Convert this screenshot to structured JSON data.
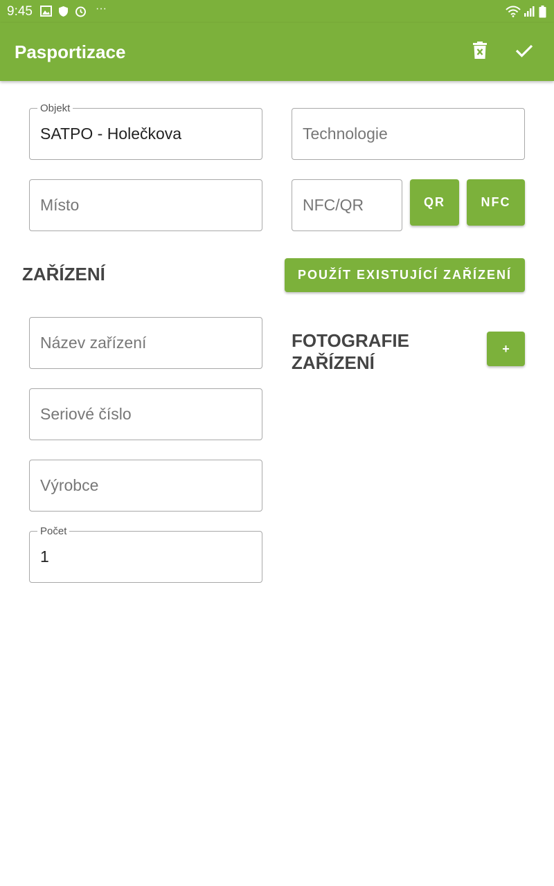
{
  "status_bar": {
    "time": "9:45",
    "overflow": "···",
    "icons": [
      "image-icon",
      "shield-icon",
      "alarm-icon",
      "wifi-icon",
      "signal-icon",
      "battery-icon"
    ]
  },
  "app_bar": {
    "title": "Pasportizace",
    "actions": [
      "delete-icon",
      "check-icon"
    ]
  },
  "form": {
    "objekt": {
      "label": "Objekt",
      "value": "SATPO - Holečkova"
    },
    "technologie": {
      "placeholder": "Technologie"
    },
    "misto": {
      "placeholder": "Místo"
    },
    "nfc_qr": {
      "placeholder": "NFC/QR"
    },
    "qr_button": "QR",
    "nfc_button": "NFC"
  },
  "zarizeni": {
    "heading": "ZAŘÍZENÍ",
    "use_existing_button": "POUŽÍT EXISTUJÍCÍ ZAŘÍZENÍ",
    "nazev": {
      "placeholder": "Název zařízení"
    },
    "seriove": {
      "placeholder": "Seriové číslo"
    },
    "vyrobce": {
      "placeholder": "Výrobce"
    },
    "pocet": {
      "label": "Počet",
      "value": "1"
    }
  },
  "fotografie": {
    "heading_line1": "FOTOGRAFIE",
    "heading_line2": "ZAŘÍZENÍ",
    "add_button": "+"
  },
  "colors": {
    "accent": "#7cb13b",
    "text": "#222222",
    "muted": "#777777"
  }
}
